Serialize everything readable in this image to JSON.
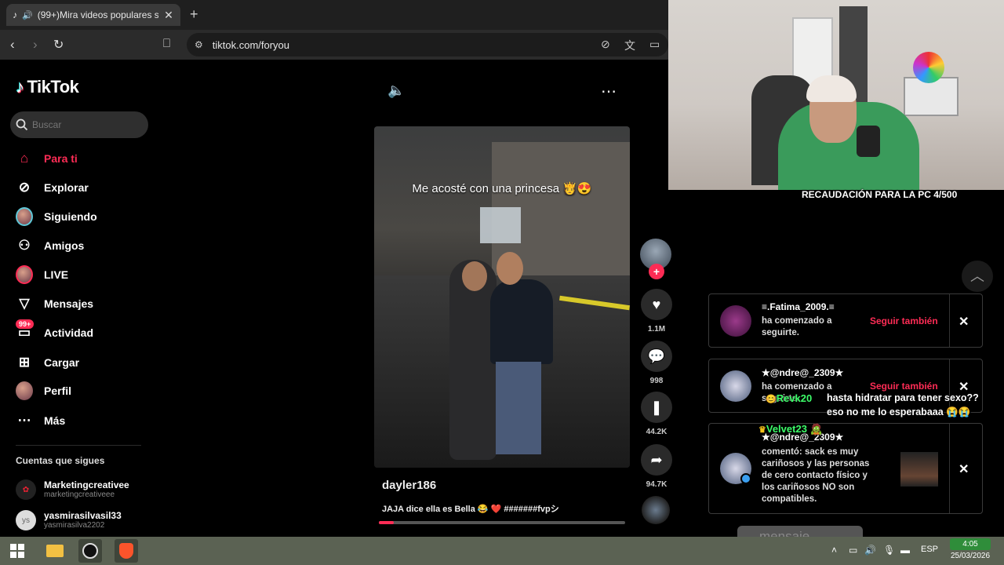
{
  "browser": {
    "tab_title": "(99+)Mira videos populares s",
    "url": "tiktok.com/foryou"
  },
  "sidebar": {
    "logo_text": "TikTok",
    "search_placeholder": "Buscar",
    "items": [
      {
        "label": "Para ti",
        "active": true
      },
      {
        "label": "Explorar"
      },
      {
        "label": "Siguiendo"
      },
      {
        "label": "Amigos"
      },
      {
        "label": "LIVE"
      },
      {
        "label": "Mensajes"
      },
      {
        "label": "Actividad"
      },
      {
        "label": "Cargar"
      },
      {
        "label": "Perfil"
      },
      {
        "label": "Más"
      }
    ],
    "activity_badge": "99+",
    "following_title": "Cuentas que sigues",
    "accounts": [
      {
        "name": "Marketingcreativee",
        "handle": "marketingcreativeee"
      },
      {
        "name": "yasmirasilvasil33",
        "handle": "yasmirasilva2202"
      }
    ]
  },
  "video": {
    "overlay_caption": "Me acosté con una princesa 🫅😍",
    "username": "dayler186",
    "description": "JAJA dice ella es Bella 😂 ❤️ #######fvpシ",
    "progress": 0.06,
    "likes": "1.1M",
    "comments": "998",
    "saves": "44.2K",
    "shares": "94.7K"
  },
  "stream": {
    "webcam_caption": "RECAUDACIÓN PARA LA PC 4/500",
    "chat": [
      {
        "user": "Revk20",
        "lines": [
          "hasta hidratar para tener sexo??",
          "eso no me lo esperabaaa 😭😭"
        ]
      },
      {
        "user": "Velvet23 🧟"
      }
    ]
  },
  "notifications": [
    {
      "name": "≡.Fatima_2009.≡",
      "text": "ha comenzado a seguirte.",
      "action": "Seguir también"
    },
    {
      "name": "★@ndre@_2309★",
      "text": "ha comenzado a seguirte.",
      "text_visible": "s",
      "action": "Seguir también"
    },
    {
      "name": "★@ndre@_2309★",
      "text": "comentó: sack es muy cariñosos y las personas de cero contacto físico y los cariñosos NO son compatibles."
    }
  ],
  "ghost_input": "mensaje",
  "taskbar": {
    "language": "ESP",
    "time": "4:05",
    "date": "25/03/2026"
  },
  "colors": {
    "accent": "#fe2c55",
    "chat_user": "#3dff6a",
    "taskbar": "#5b6253"
  }
}
